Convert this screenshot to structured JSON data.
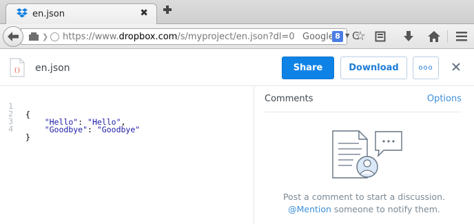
{
  "browser": {
    "tab_title": "en.json",
    "tab_close": "✖",
    "url_prefix": "https://www.",
    "url_domain": "dropbox.com",
    "url_path": "/s/myproject/en.json?dl=0",
    "search_engine": "Google",
    "search_engine_glyph": "8",
    "reload_glyph": "C"
  },
  "header": {
    "file_name": "en.json",
    "share_label": "Share",
    "download_label": "Download",
    "more_label": "ooo"
  },
  "code": {
    "lines": [
      {
        "num": "1",
        "text": "{"
      },
      {
        "num": "2",
        "key": "\"Hello\"",
        "sep": ": ",
        "value": "\"Hello\"",
        "trail": ","
      },
      {
        "num": "3",
        "key": "\"Goodbye\"",
        "sep": ": ",
        "value": "\"Goodbye\"",
        "trail": ""
      },
      {
        "num": "4",
        "text": "}"
      }
    ]
  },
  "comments": {
    "title": "Comments",
    "options_label": "Options",
    "empty_line1": "Post a comment to start a discussion.",
    "mention": "@Mention",
    "empty_line2_rest": " someone to notify them."
  },
  "colors": {
    "accent": "#0f82e6",
    "link": "#3d8fd9",
    "dropbox_logo": "#0d7fe2"
  }
}
